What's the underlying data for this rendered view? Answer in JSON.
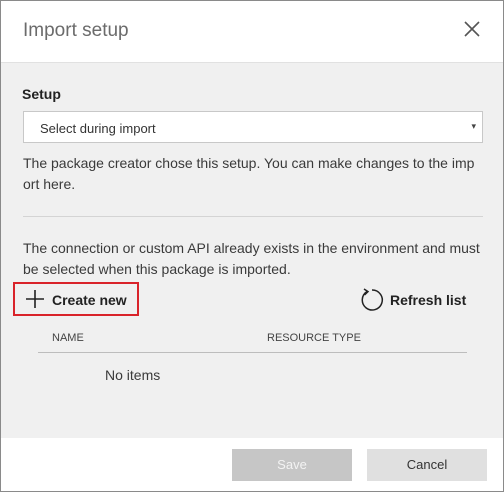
{
  "dialog": {
    "title": "Import setup",
    "close_icon": "close-icon"
  },
  "setup": {
    "label": "Setup",
    "selected_value": "Select during import",
    "arrow": "▾",
    "note": "The package creator chose this setup. You can make changes to the import here."
  },
  "connection": {
    "message": "The connection or custom API already exists in the environment and must be selected when this package is imported.",
    "create_new_label": "Create new",
    "create_new_icon": "plus-icon",
    "refresh_label": "Refresh list",
    "refresh_icon": "refresh-icon"
  },
  "table": {
    "columns": [
      "NAME",
      "RESOURCE TYPE"
    ],
    "empty_text": "No items"
  },
  "footer": {
    "save_label": "Save",
    "cancel_label": "Cancel"
  },
  "colors": {
    "highlight_border": "#d9232a",
    "disabled_button": "#c6c6c6",
    "secondary_button": "#e0e0e0"
  }
}
